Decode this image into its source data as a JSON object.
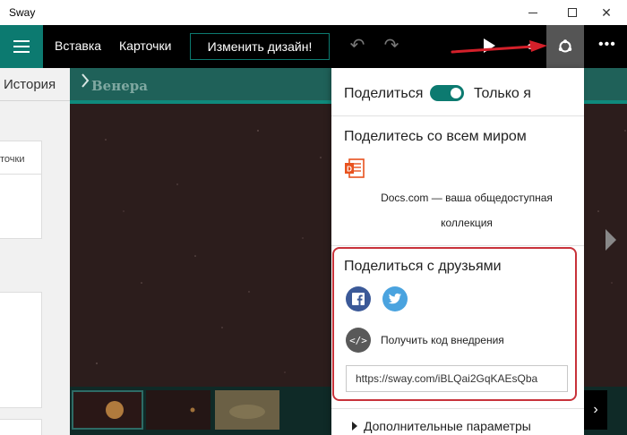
{
  "window": {
    "title": "Sway"
  },
  "toolbar": {
    "insert_label": "Вставка",
    "cards_label": "Карточки",
    "design_label": "Изменить дизайн!"
  },
  "sidebar": {
    "history_label": "История",
    "card_text": "точки"
  },
  "preview": {
    "title": "Венера"
  },
  "share": {
    "share_label": "Поделиться",
    "toggle_label": "Только я",
    "toggle_on": true,
    "world_heading": "Поделитесь со всем миром",
    "docs_line1": "Docs.com — ваша общедоступная",
    "docs_line2": "коллекция",
    "friends_heading": "Поделиться с друзьями",
    "embed_label": "Получить код внедрения",
    "link_value": "https://sway.com/iBLQai2GqKAEsQba",
    "advanced_label": "Дополнительные параметры"
  },
  "colors": {
    "accent": "#0c7a70",
    "highlight": "#c8323a",
    "facebook": "#3b5998",
    "twitter": "#4aa3df"
  },
  "icons": [
    "hamburger-icon",
    "undo-icon",
    "redo-icon",
    "play-icon",
    "share-icon",
    "more-icon",
    "facebook-icon",
    "twitter-icon",
    "embed-icon",
    "docs-icon"
  ]
}
